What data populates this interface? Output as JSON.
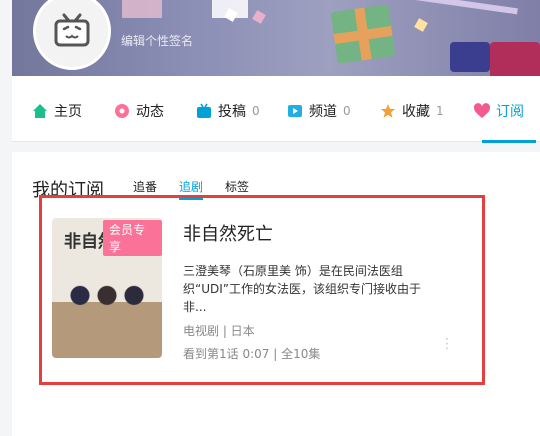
{
  "profile": {
    "signature_placeholder": "编辑个性签名",
    "avatar_icon": "tv-logo-icon"
  },
  "nav": {
    "items": [
      {
        "label": "主页",
        "count": "",
        "icon": "home-icon"
      },
      {
        "label": "动态",
        "count": "",
        "icon": "flower-icon"
      },
      {
        "label": "投稿",
        "count": "0",
        "icon": "tv-icon"
      },
      {
        "label": "频道",
        "count": "0",
        "icon": "play-icon"
      },
      {
        "label": "收藏",
        "count": "1",
        "icon": "star-icon"
      },
      {
        "label": "订阅",
        "count": "",
        "icon": "heart-icon"
      }
    ],
    "active_color": "#00a1d6"
  },
  "subscriptions": {
    "title": "我的订阅",
    "tabs": [
      "追番",
      "追剧",
      "标签"
    ],
    "active_tab": "追剧"
  },
  "card": {
    "badge": "会员专享",
    "poster_title": "非自然死亡",
    "title": "非自然死亡",
    "desc_line1": "三澄美琴（石原里美 饰）是在民间法医组",
    "desc_line2": "织“UDI”工作的女法医，该组织专门接收由于非...",
    "meta1": "电视剧 | 日本",
    "meta2": "看到第1话 0:07 | 全10集",
    "more_icon": "more-vertical-icon"
  }
}
